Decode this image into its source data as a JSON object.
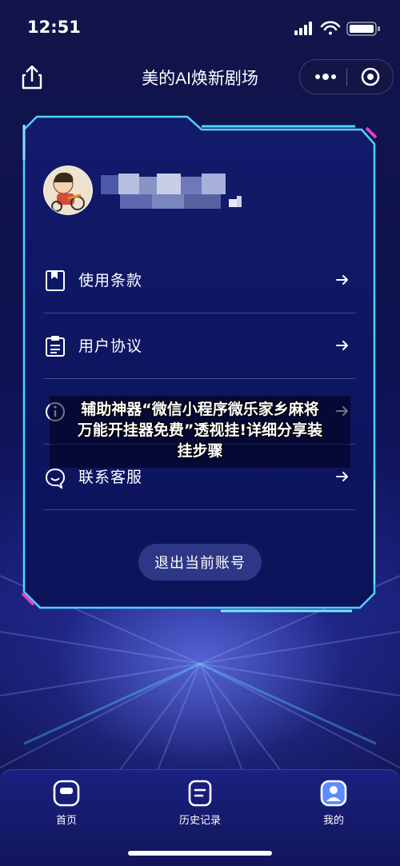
{
  "status_bar": {
    "time": "12:51"
  },
  "nav": {
    "title": "美的AI焕新剧场",
    "more_icon": "more-dots-icon",
    "close_icon": "target-close-icon",
    "share_icon": "share-icon"
  },
  "profile": {
    "avatar_icon": "cartoon-avatar",
    "username_blurred": true
  },
  "menu": [
    {
      "label": "使用条款",
      "icon": "bookmark-icon"
    },
    {
      "label": "用户协议",
      "icon": "clipboard-icon"
    },
    {
      "label": "",
      "icon": "info-icon"
    },
    {
      "label": "联系客服",
      "icon": "chat-icon"
    }
  ],
  "logout_label": "退出当前账号",
  "overlay": {
    "line1": "辅助神器“微信小程序微乐家乡麻将",
    "line2": "万能开挂器免费”透视挂!详细分享装",
    "line3": "挂步骤"
  },
  "tabs": [
    {
      "label": "首页",
      "icon": "home-icon",
      "active": false
    },
    {
      "label": "历史记录",
      "icon": "history-icon",
      "active": false
    },
    {
      "label": "我的",
      "icon": "profile-icon",
      "active": true
    }
  ],
  "colors": {
    "accent_cyan": "#35c6ff",
    "accent_magenta": "#e040c8",
    "panel_bg": "#0e1760"
  }
}
